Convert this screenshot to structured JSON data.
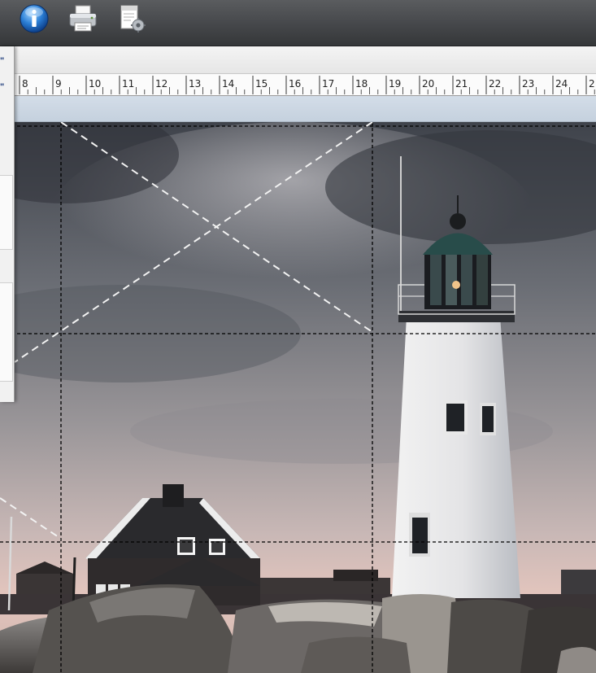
{
  "toolbar": {
    "buttons": [
      {
        "name": "info",
        "icon": "info-icon"
      },
      {
        "name": "print",
        "icon": "printer-icon"
      },
      {
        "name": "page-setup",
        "icon": "page-setup-icon"
      }
    ]
  },
  "side_panel": {
    "marks": [
      "\"",
      "\""
    ]
  },
  "ruler": {
    "numbers": [
      "8",
      "9",
      "10",
      "11",
      "12",
      "13",
      "14",
      "15",
      "16",
      "17",
      "18",
      "19",
      "20",
      "21",
      "22",
      "23",
      "24",
      "2"
    ]
  },
  "colors": {
    "toolbar": "#45474a",
    "ruler": "#fbfbfb",
    "blue_strip": "#c9d4e1",
    "guide_line": "#000000",
    "diagonal_guide": "#ffffff"
  }
}
